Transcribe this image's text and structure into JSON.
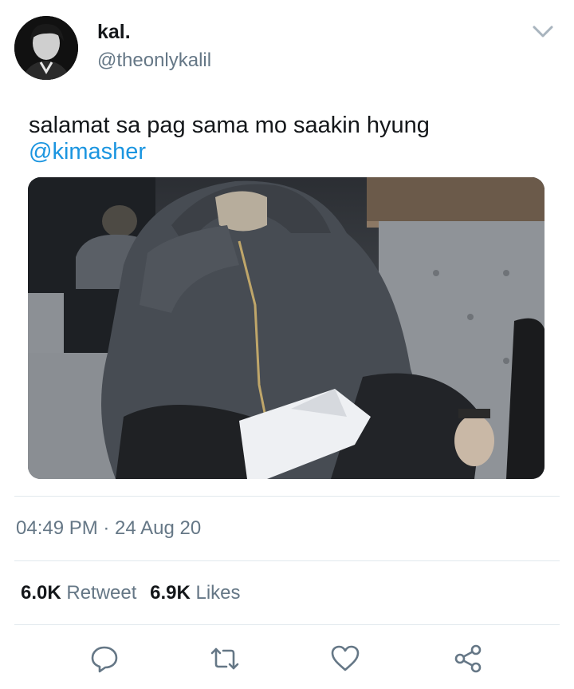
{
  "author": {
    "display_name": "kal.",
    "handle": "@theonlykalil",
    "avatar_icon": "avatar-photo"
  },
  "tweet": {
    "text": "salamat sa pag sama mo saakin hyung",
    "mention": "@kimasher",
    "media_icon": "photo"
  },
  "meta": {
    "timestamp": "04:49 PM · 24 Aug 20"
  },
  "stats": {
    "retweets_count": "6.0K",
    "retweets_label": "Retweet",
    "likes_count": "6.9K",
    "likes_label": "Likes"
  },
  "actions": {
    "reply_icon": "reply-icon",
    "retweet_icon": "retweet-icon",
    "like_icon": "heart-icon",
    "share_icon": "share-icon"
  },
  "colors": {
    "link": "#1b95e0",
    "secondary_text": "#657786",
    "divider": "#e1e8ed"
  }
}
